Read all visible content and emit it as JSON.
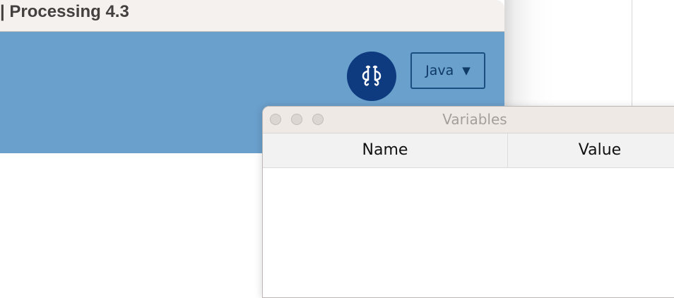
{
  "processing_window": {
    "title": "| Processing 4.3",
    "mode_selector": {
      "label": "Java",
      "arrow": "▼"
    },
    "debug_button": {
      "icon": "butterfly-debug-icon"
    }
  },
  "variables_window": {
    "title": "Variables",
    "columns": [
      "Name",
      "Value"
    ]
  },
  "colors": {
    "toolbar": "#6aa0cc",
    "debug_button": "#0e3a80",
    "titlebar": "#f5f1ee"
  }
}
